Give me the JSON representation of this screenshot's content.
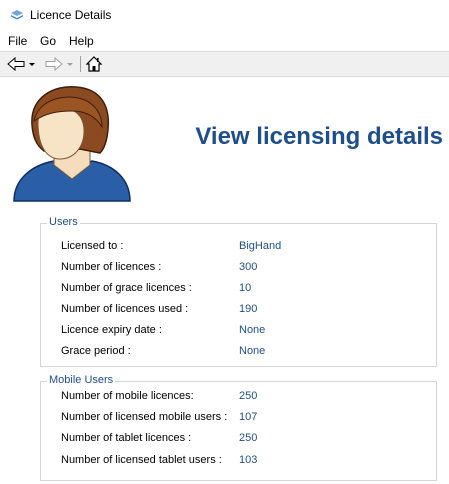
{
  "window": {
    "title": "Licence Details"
  },
  "menu": {
    "items": [
      "File",
      "Go",
      "Help"
    ]
  },
  "toolbar": {
    "back": "back-arrow-icon",
    "forward": "forward-arrow-icon",
    "home": "home-icon"
  },
  "heading": "View licensing details",
  "colors": {
    "heading": "#1f4e8c",
    "value": "#1f4e8c",
    "avatar_shirt": "#2a5fa8",
    "avatar_hair": "#8b4a1f"
  },
  "users": {
    "legend": "Users",
    "rows": [
      {
        "label": "Licensed to :",
        "value": "BigHand"
      },
      {
        "label": "Number of licences :",
        "value": "300"
      },
      {
        "label": "Number of grace licences :",
        "value": "10"
      },
      {
        "label": "Number of licences used :",
        "value": "190"
      },
      {
        "label": "Licence expiry date :",
        "value": "None"
      },
      {
        "label": "Grace period :",
        "value": "None"
      }
    ]
  },
  "mobile": {
    "legend": "Mobile Users",
    "rows": [
      {
        "label": "Number of mobile licences:",
        "value": "250"
      },
      {
        "label": "Number of licensed mobile users :",
        "value": "107"
      },
      {
        "label": "Number of tablet licences :",
        "value": "250"
      },
      {
        "label": "Number of licensed tablet users :",
        "value": "103"
      }
    ]
  }
}
